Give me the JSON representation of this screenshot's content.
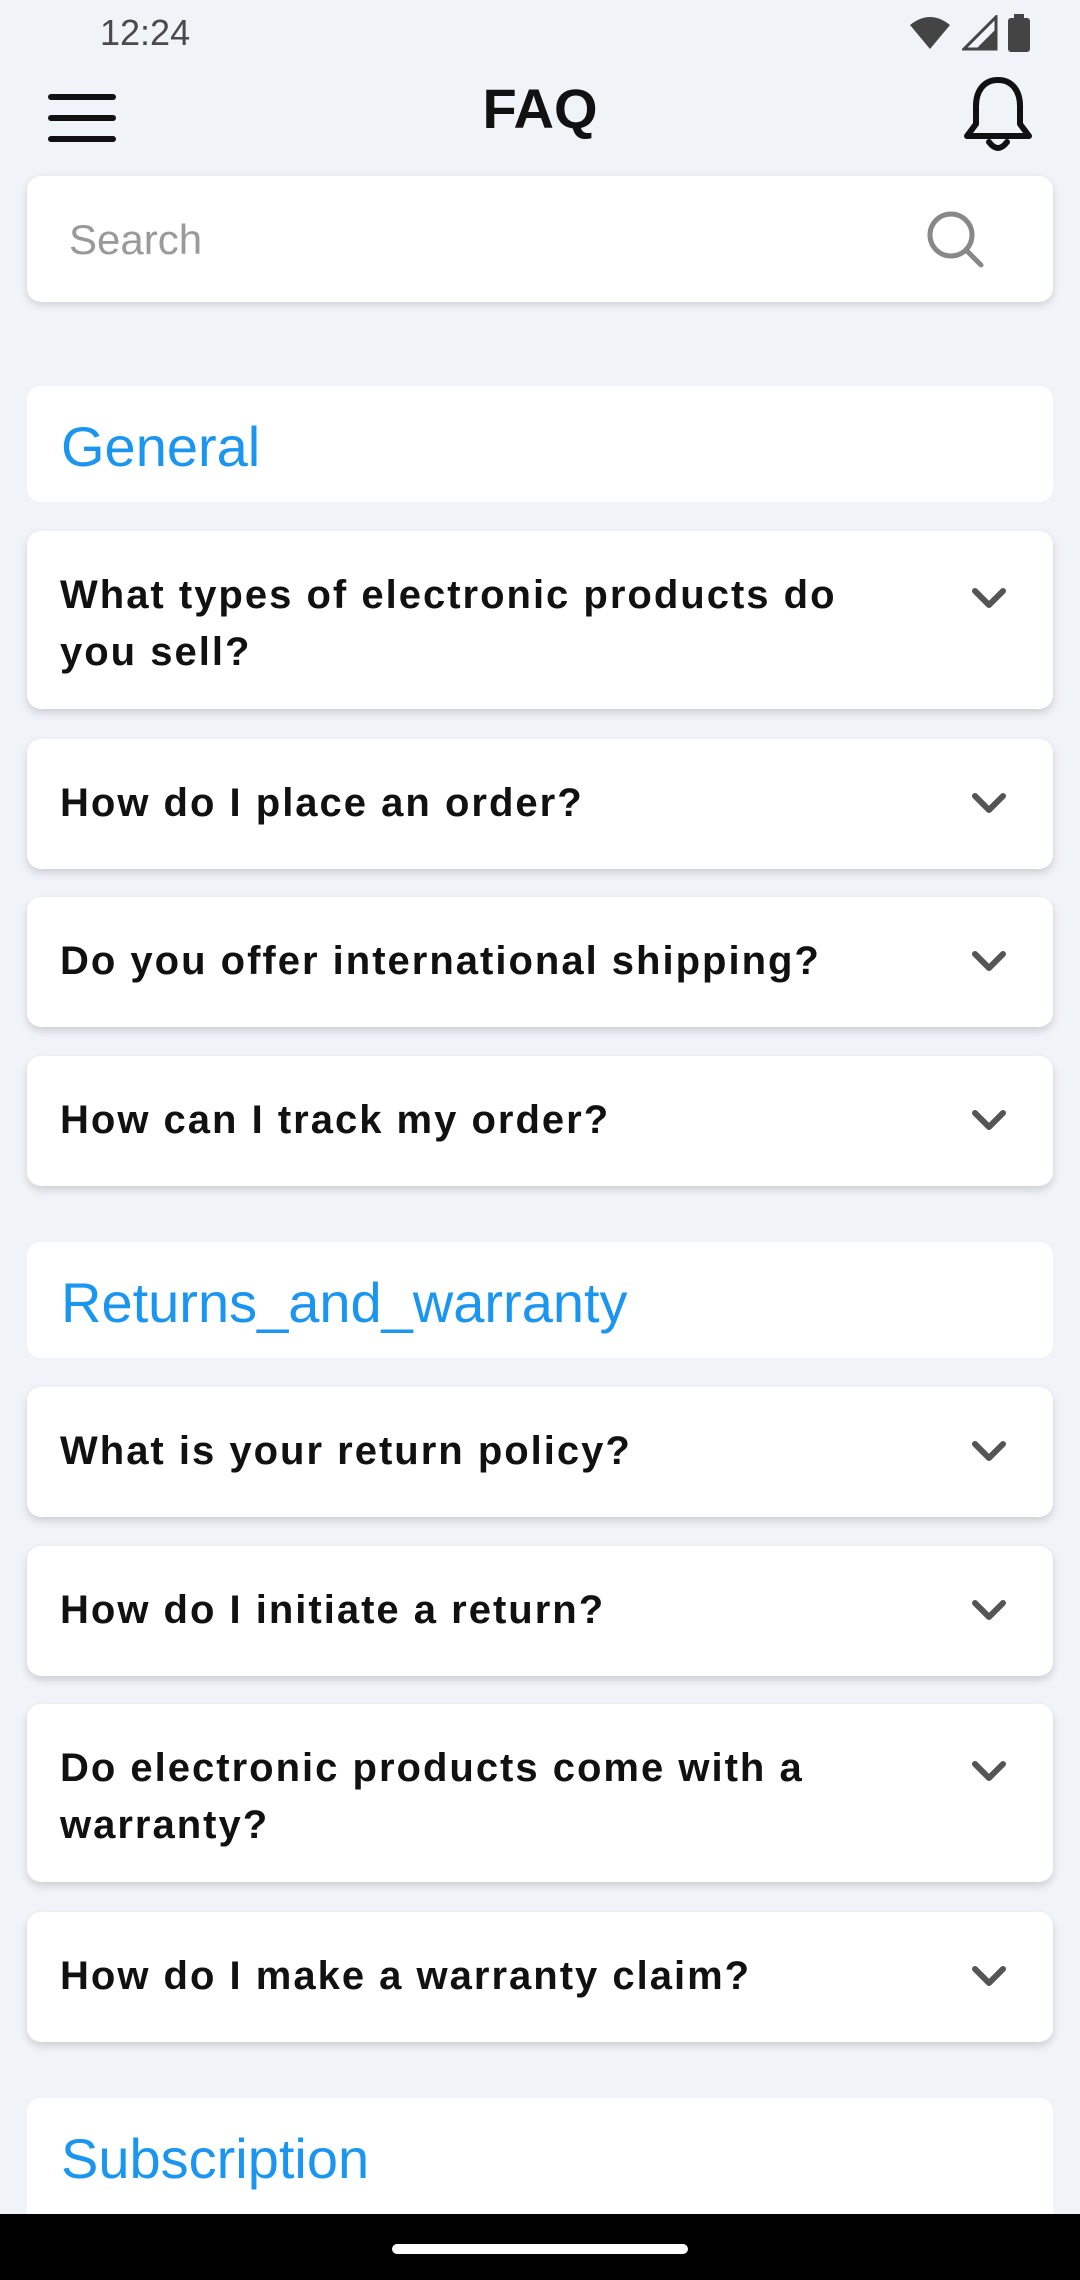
{
  "status": {
    "time": "12:24"
  },
  "header": {
    "title": "FAQ"
  },
  "search": {
    "placeholder": "Search"
  },
  "sections": [
    {
      "title": "General"
    },
    {
      "title": "Returns_and_warranty"
    },
    {
      "title": "Subscription"
    }
  ],
  "faqs": [
    "What types of electronic products do you sell?",
    "How do I place an order?",
    "Do you offer international shipping?",
    "How can I track my order?",
    "What is your return policy?",
    "How do I initiate a return?",
    "Do electronic products come with a warranty?",
    "How do I make a warranty claim?"
  ],
  "colors": {
    "accent": "#1a96f0",
    "background": "#f0f3f8"
  }
}
